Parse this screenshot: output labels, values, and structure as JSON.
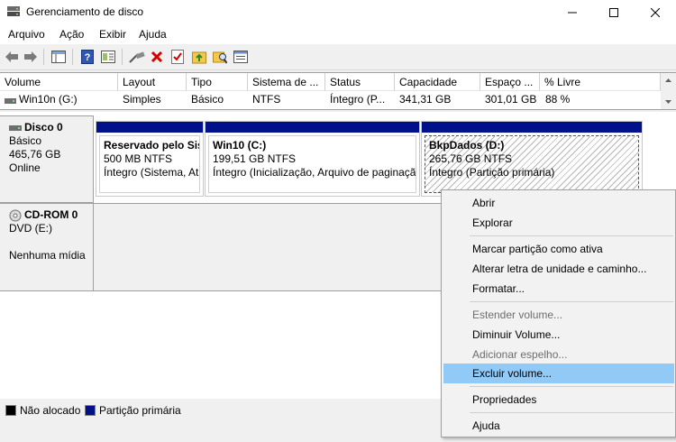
{
  "window": {
    "title": "Gerenciamento de disco"
  },
  "menu": [
    "Arquivo",
    "Ação",
    "Exibir",
    "Ajuda"
  ],
  "volume_list": {
    "headers": [
      "Volume",
      "Layout",
      "Tipo",
      "Sistema de ...",
      "Status",
      "Capacidade",
      "Espaço ...",
      "% Livre"
    ],
    "rows": [
      [
        "Win10n (G:)",
        "Simples",
        "Básico",
        "NTFS",
        "Íntegro (P...",
        "341,31 GB",
        "301,01 GB",
        "88 %"
      ]
    ]
  },
  "disks": [
    {
      "name": "Disco  0",
      "type": "Básico",
      "size": "465,76 GB",
      "status": "Online",
      "partitions": [
        {
          "name": "Reservado pelo Sist",
          "size": "500 MB NTFS",
          "status": "Íntegro (Sistema, Ati"
        },
        {
          "name": "Win10  (C:)",
          "size": "199,51 GB NTFS",
          "status": "Íntegro (Inicialização, Arquivo de paginaçã"
        },
        {
          "name": "BkpDados  (D:)",
          "size": "265,76 GB NTFS",
          "status": "Íntegro (Partição primária)"
        }
      ]
    },
    {
      "name": "CD-ROM 0",
      "type": "DVD (E:)",
      "media": "Nenhuma mídia"
    }
  ],
  "legend": [
    {
      "label": "Não alocado",
      "color": "#000000"
    },
    {
      "label": "Partição primária",
      "color": "#00118b"
    }
  ],
  "context_menu": {
    "items": [
      {
        "label": "Abrir",
        "enabled": true
      },
      {
        "label": "Explorar",
        "enabled": true
      },
      {
        "label": "Marcar partição como ativa",
        "enabled": true
      },
      {
        "label": "Alterar letra de unidade e caminho...",
        "enabled": true
      },
      {
        "label": "Formatar...",
        "enabled": true
      },
      {
        "label": "Estender volume...",
        "enabled": false
      },
      {
        "label": "Diminuir Volume...",
        "enabled": true
      },
      {
        "label": "Adicionar espelho...",
        "enabled": false
      },
      {
        "label": "Excluir volume...",
        "enabled": true,
        "highlighted": true
      },
      {
        "label": "Propriedades",
        "enabled": true
      },
      {
        "label": "Ajuda",
        "enabled": true
      }
    ]
  },
  "colors": {
    "primary_partition": "#00118b",
    "highlight": "#91c9f7",
    "delete_icon": "#d40000"
  }
}
